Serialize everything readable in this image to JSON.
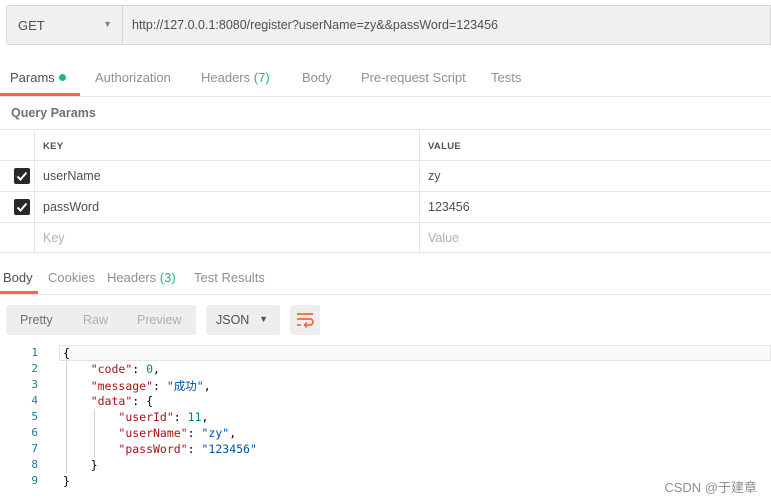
{
  "request": {
    "method": "GET",
    "url": "http://127.0.0.1:8080/register?userName=zy&&passWord=123456"
  },
  "request_tabs": {
    "params": "Params",
    "authorization": "Authorization",
    "headers": "Headers",
    "headers_count": "(7)",
    "body": "Body",
    "prerequest": "Pre-request Script",
    "tests": "Tests"
  },
  "query_params": {
    "title": "Query Params",
    "key_header": "KEY",
    "value_header": "VALUE",
    "rows": [
      {
        "key": "userName",
        "value": "zy"
      },
      {
        "key": "passWord",
        "value": "123456"
      }
    ],
    "key_placeholder": "Key",
    "value_placeholder": "Value"
  },
  "response_tabs": {
    "body": "Body",
    "cookies": "Cookies",
    "headers": "Headers",
    "headers_count": "(3)",
    "test_results": "Test Results"
  },
  "toolbar": {
    "pretty": "Pretty",
    "raw": "Raw",
    "preview": "Preview",
    "format": "JSON"
  },
  "code": {
    "line_numbers": [
      "1",
      "2",
      "3",
      "4",
      "5",
      "6",
      "7",
      "8",
      "9"
    ],
    "open_brace": "{",
    "close_brace": "}",
    "code_key": "\"code\"",
    "code_value": "0",
    "message_key": "\"message\"",
    "message_value": "\"成功\"",
    "data_key": "\"data\"",
    "data_open": "{",
    "data_close": "}",
    "userid_key": "\"userId\"",
    "userid_value": "11",
    "username_key": "\"userName\"",
    "username_value": "\"zy\"",
    "password_key": "\"passWord\"",
    "password_value": "\"123456\""
  },
  "watermark": "CSDN @于建章",
  "colors": {
    "accent": "#f26b3a",
    "green": "#26b47f"
  }
}
